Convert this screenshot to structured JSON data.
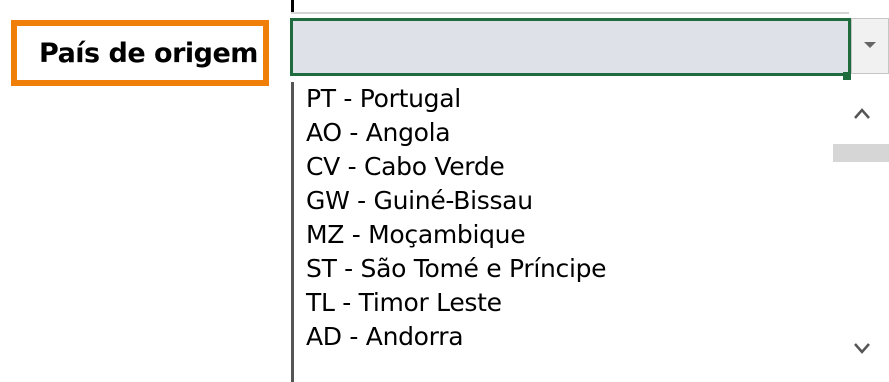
{
  "field": {
    "label": "País de origem",
    "value": ""
  },
  "dropdown": {
    "items": [
      "PT - Portugal",
      "AO - Angola",
      "CV - Cabo Verde",
      "GW - Guiné-Bissau",
      "MZ - Moçambique",
      "ST - São Tomé e Príncipe",
      "TL - Timor Leste",
      "AD - Andorra"
    ]
  },
  "colors": {
    "highlight_border": "#f07f09",
    "active_cell_border": "#1e6b3d",
    "cell_fill": "#dee2e8"
  },
  "icons": {
    "dropdown": "dropdown-arrow-icon",
    "scroll_up": "chevron-up-icon",
    "scroll_down": "chevron-down-icon"
  }
}
